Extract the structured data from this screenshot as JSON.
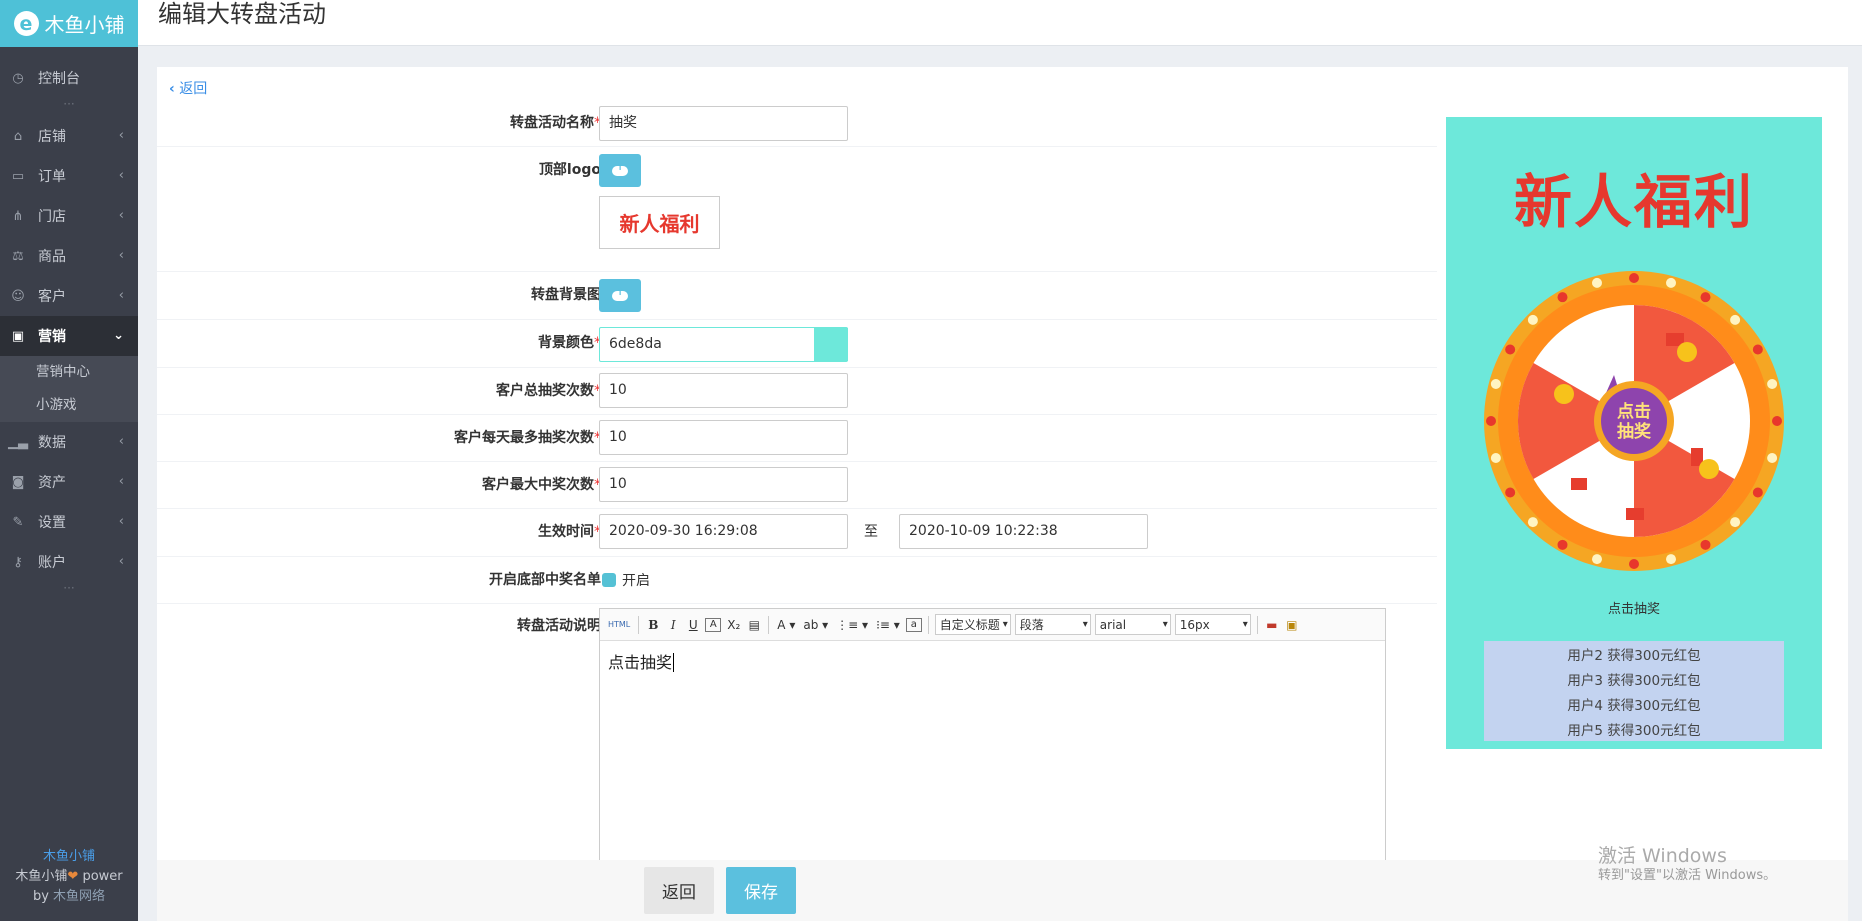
{
  "brand": {
    "name": "木鱼小铺"
  },
  "sidebar": {
    "items": [
      {
        "label": "控制台",
        "icon": "dashboard-icon"
      },
      {
        "label": "店铺",
        "icon": "shop-icon"
      },
      {
        "label": "订单",
        "icon": "order-icon"
      },
      {
        "label": "门店",
        "icon": "store-icon"
      },
      {
        "label": "商品",
        "icon": "goods-icon"
      },
      {
        "label": "客户",
        "icon": "customer-icon"
      },
      {
        "label": "营销",
        "icon": "gift-icon"
      },
      {
        "label": "数据",
        "icon": "chart-icon"
      },
      {
        "label": "资产",
        "icon": "asset-icon"
      },
      {
        "label": "设置",
        "icon": "wrench-icon"
      },
      {
        "label": "账户",
        "icon": "key-icon"
      }
    ],
    "marketing_sub": [
      "营销中心",
      "小游戏"
    ],
    "footer": {
      "line1": "木鱼小铺",
      "line2a": "木鱼小铺",
      "line2b": "power",
      "line3a": "by",
      "line3b": "木鱼网络"
    }
  },
  "header": {
    "title": "编辑大转盘活动"
  },
  "back_link": "返回",
  "form": {
    "name": {
      "label": "转盘活动名称",
      "value": "抽奖"
    },
    "logo": {
      "label": "顶部logo",
      "thumb_text": "新人福利"
    },
    "bg_image": {
      "label": "转盘背景图"
    },
    "bg_color": {
      "label": "背景颜色",
      "value": "6de8da",
      "swatch": "#6de8da"
    },
    "total_draws": {
      "label": "客户总抽奖次数",
      "value": "10"
    },
    "daily_draws": {
      "label": "客户每天最多抽奖次数",
      "value": "10"
    },
    "max_wins": {
      "label": "客户最大中奖次数",
      "value": "10"
    },
    "time": {
      "label": "生效时间",
      "start": "2020-09-30 16:29:08",
      "sep": "至",
      "end": "2020-10-09 10:22:38"
    },
    "winner_list": {
      "label": "开启底部中奖名单",
      "option": "开启",
      "checked": true
    },
    "description": {
      "label": "转盘活动说明",
      "content": "点击抽奖"
    }
  },
  "editor_toolbar": {
    "custom_title": "自定义标题",
    "paragraph": "段落",
    "font": "arial",
    "size": "16px"
  },
  "preview": {
    "title": "新人福利",
    "wheel_center": [
      "点击",
      "抽奖"
    ],
    "caption": "点击抽奖",
    "winners": [
      "用户2 获得300元红包",
      "用户3 获得300元红包",
      "用户4 获得300元红包",
      "用户5 获得300元红包"
    ],
    "bg_color": "#6de8da"
  },
  "buttons": {
    "back": "返回",
    "save": "保存"
  },
  "watermark": {
    "line1": "激活 Windows",
    "line2": "转到\"设置\"以激活 Windows。"
  }
}
